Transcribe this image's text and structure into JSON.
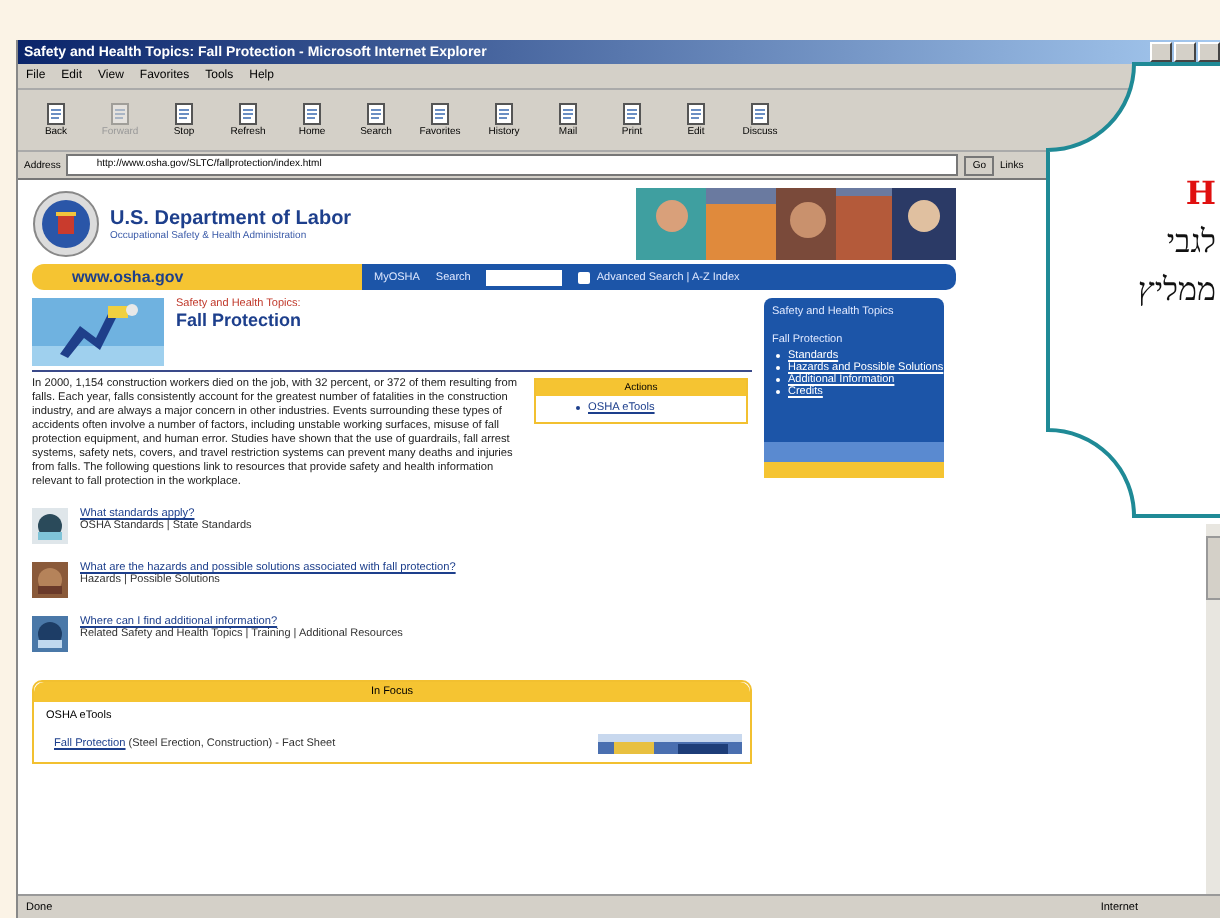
{
  "window": {
    "title": "Safety and Health Topics: Fall Protection - Microsoft Internet Explorer"
  },
  "menu": [
    "File",
    "Edit",
    "View",
    "Favorites",
    "Tools",
    "Help"
  ],
  "toolbar": [
    {
      "label": "Back",
      "disabled": false
    },
    {
      "label": "Forward",
      "disabled": true
    },
    {
      "label": "Stop",
      "disabled": false
    },
    {
      "label": "Refresh",
      "disabled": false
    },
    {
      "label": "Home",
      "disabled": false
    },
    {
      "label": "Search",
      "disabled": false
    },
    {
      "label": "Favorites",
      "disabled": false
    },
    {
      "label": "History",
      "disabled": false
    },
    {
      "label": "Mail",
      "disabled": false
    },
    {
      "label": "Print",
      "disabled": false
    },
    {
      "label": "Edit",
      "disabled": false
    },
    {
      "label": "Discuss",
      "disabled": false
    }
  ],
  "address": {
    "label": "Address",
    "value": "http://www.osha.gov/SLTC/fallprotection/index.html",
    "go": "Go",
    "links": "Links"
  },
  "page": {
    "agency": "U.S. Department of Labor",
    "subtitle": "Occupational Safety & Health Administration",
    "site": "www.osha.gov",
    "nav_link": "MyOSHA",
    "search_label": "Search",
    "advanced": "Advanced Search | A-Z Index",
    "kicker": "Safety and Health Topics:",
    "title": "Fall Protection",
    "intro": "In 2000, 1,154 construction workers died on the job, with 32 percent, or 372 of them resulting from falls. Each year, falls consistently account for the greatest number of fatalities in the construction industry, and are always a major concern in other industries. Events surrounding these types of accidents often involve a number of factors, including unstable working surfaces, misuse of fall protection equipment, and human error. Studies have shown that the use of guardrails, fall arrest systems, safety nets, covers, and travel restriction systems can prevent many deaths and injuries from falls. The following questions link to resources that provide safety and health information relevant to fall protection in the workplace.",
    "actions": {
      "title": "Actions",
      "items": [
        "OSHA eTools"
      ]
    },
    "questions": [
      {
        "title": "What standards apply?",
        "links": "OSHA Standards | State Standards"
      },
      {
        "title": "What are the hazards and possible solutions associated with fall protection?",
        "links": "Hazards | Possible Solutions"
      },
      {
        "title": "Where can I find additional information?",
        "links": "Related Safety and Health Topics | Training | Additional Resources"
      }
    ],
    "in_focus": {
      "title": "In Focus",
      "subtitle": "OSHA eTools",
      "link": "Fall Protection",
      "note": "(Steel Erection, Construction) - Fact Sheet"
    },
    "sidebar": {
      "title": "Safety and Health Topics",
      "section": "Fall Protection",
      "items": [
        "Standards",
        "Hazards and Possible Solutions",
        "Additional Information",
        "Credits"
      ]
    }
  },
  "status_bar": {
    "left": "Done",
    "zone": "Internet"
  },
  "callout": {
    "lines": [
      {
        "text": "H",
        "kind": "accent"
      },
      {
        "text": "לגבי",
        "kind": "plain"
      },
      {
        "text": "ממליץ",
        "kind": "plain"
      }
    ]
  }
}
